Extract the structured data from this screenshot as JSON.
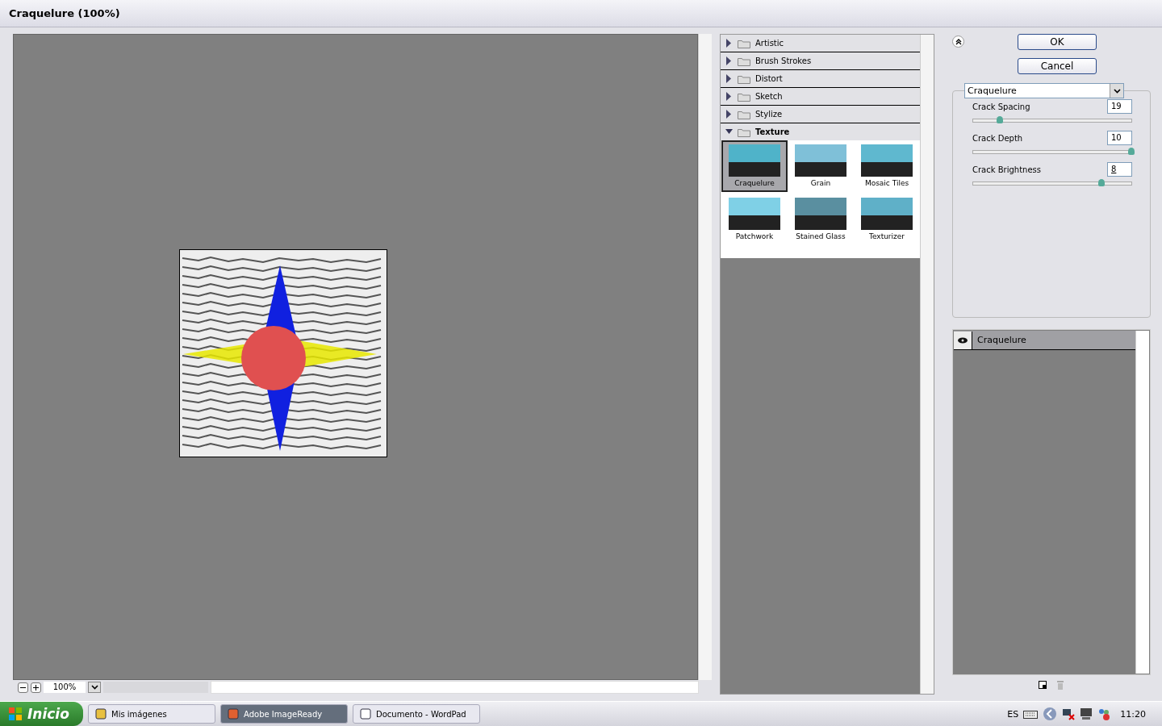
{
  "window": {
    "title": "Craquelure (100%)"
  },
  "preview": {
    "zoom": "100%"
  },
  "categories": [
    {
      "label": "Artistic",
      "expanded": false
    },
    {
      "label": "Brush Strokes",
      "expanded": false
    },
    {
      "label": "Distort",
      "expanded": false
    },
    {
      "label": "Sketch",
      "expanded": false
    },
    {
      "label": "Stylize",
      "expanded": false
    },
    {
      "label": "Texture",
      "expanded": true,
      "filters": [
        {
          "label": "Craquelure",
          "selected": true
        },
        {
          "label": "Grain",
          "selected": false
        },
        {
          "label": "Mosaic Tiles",
          "selected": false
        },
        {
          "label": "Patchwork",
          "selected": false
        },
        {
          "label": "Stained Glass",
          "selected": false
        },
        {
          "label": "Texturizer",
          "selected": false
        }
      ]
    }
  ],
  "buttons": [
    "OK",
    "Cancel"
  ],
  "filter_select": "Craquelure",
  "params": [
    {
      "label": "Crack Spacing",
      "value": "19",
      "level": 0.17
    },
    {
      "label": "Crack Depth",
      "value": "10",
      "level": 1.0
    },
    {
      "label": "Crack Brightness",
      "value": "8",
      "level": 0.81
    }
  ],
  "layers": [
    {
      "label": "Craquelure",
      "visible": true
    }
  ],
  "taskbar": {
    "start": "Inicio",
    "tasks": [
      {
        "label": "Mis imágenes",
        "selected": false
      },
      {
        "label": "Adobe ImageReady",
        "selected": true
      },
      {
        "label": "Documento - WordPad",
        "selected": false
      }
    ],
    "language": "ES",
    "clock": "11:20"
  }
}
